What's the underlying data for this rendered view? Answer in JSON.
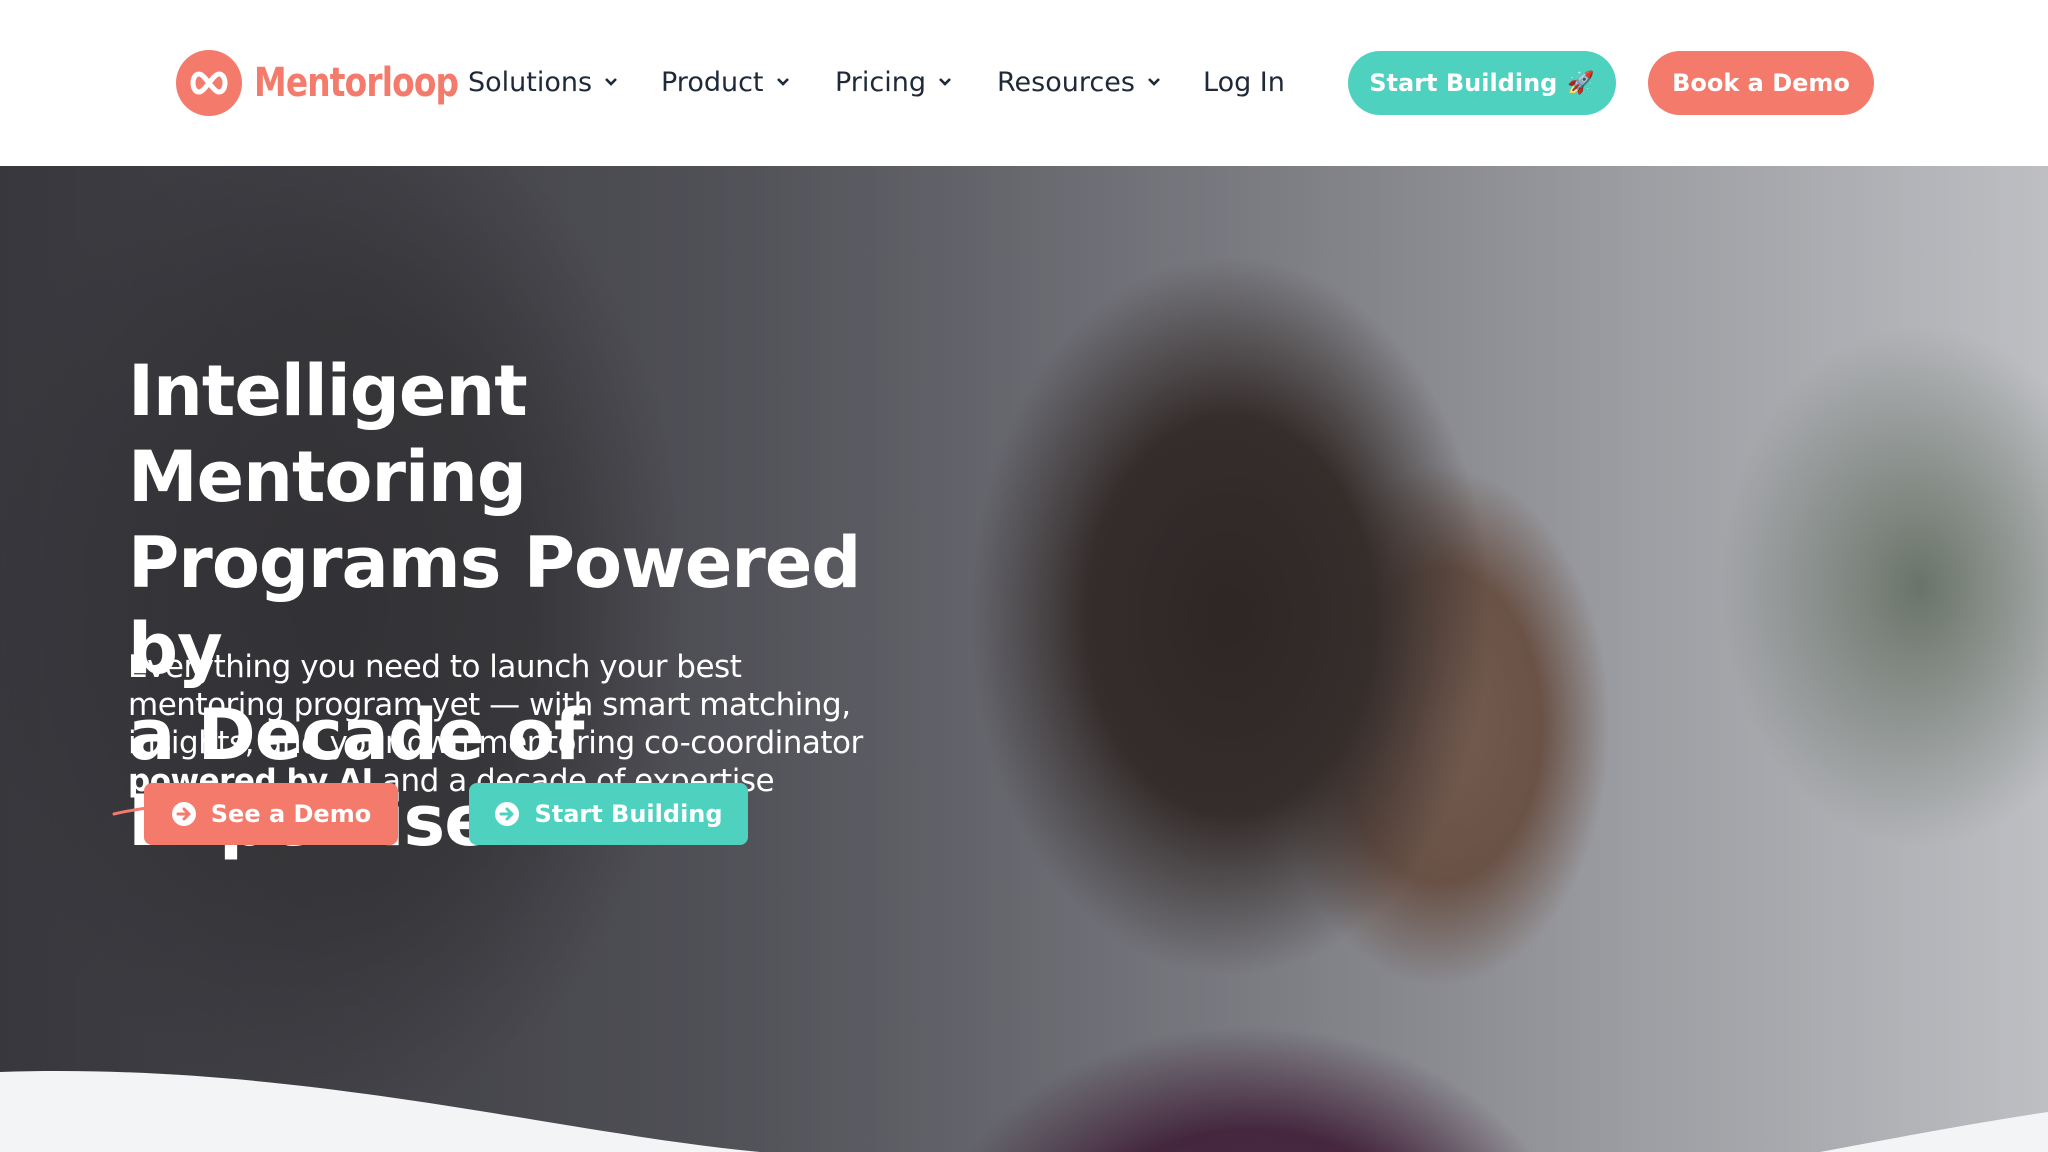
{
  "brand": {
    "name": "Mentorloop",
    "accent": "#f47a6b",
    "teal": "#4fd1c0"
  },
  "nav": {
    "items": [
      {
        "label": "Solutions",
        "has_dropdown": true
      },
      {
        "label": "Product",
        "has_dropdown": true
      },
      {
        "label": "Pricing",
        "has_dropdown": true
      },
      {
        "label": "Resources",
        "has_dropdown": true
      },
      {
        "label": "Log In",
        "has_dropdown": false
      }
    ],
    "start_building": "Start Building",
    "start_building_icon": "rocket-icon",
    "book_demo": "Book a Demo"
  },
  "hero": {
    "title_lines": [
      "Intelligent Mentoring",
      "Programs Powered by",
      "a Decade of Expertise"
    ],
    "subtitle_lines": [
      "Everything you need to launch your best",
      "mentoring program yet — with smart matching,",
      "insights, and your own mentoring co-coordinator"
    ],
    "subtitle_highlight": "powered by AI",
    "subtitle_tail": " and a decade of expertise",
    "cta_demo": "See a Demo",
    "cta_start": "Start Building",
    "cta_icon": "arrow-right-circle-icon"
  }
}
